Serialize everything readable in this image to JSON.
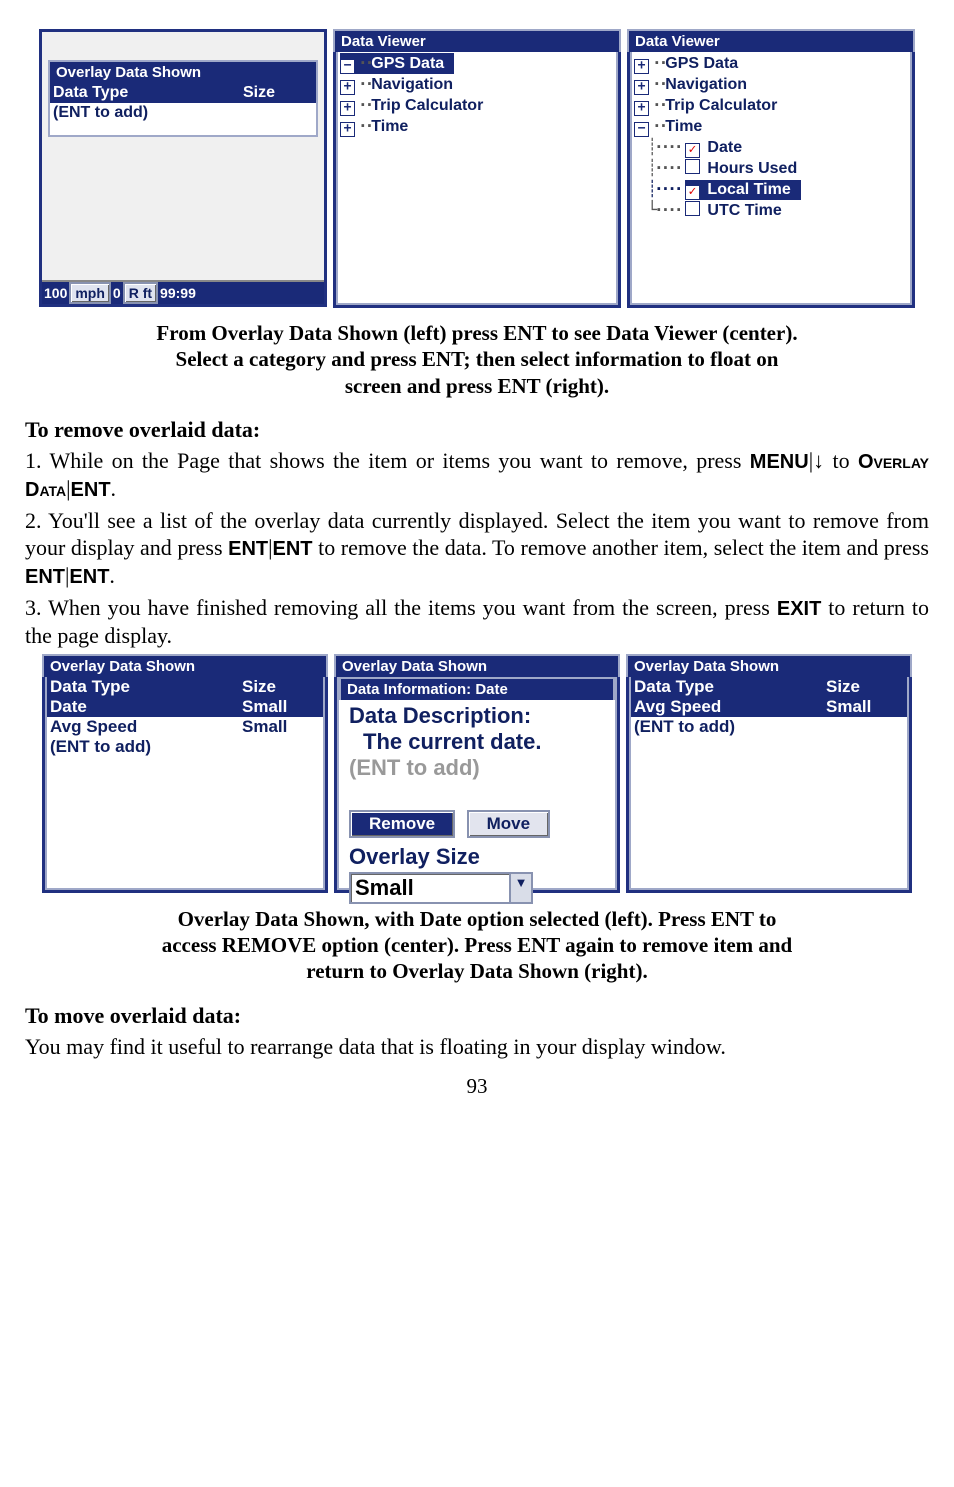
{
  "fig1": {
    "left": {
      "title": "Overlay Data Shown",
      "header_type": "Data Type",
      "header_size": "Size",
      "row1": "(ENT to add)",
      "status": {
        "speed": "100",
        "speed_u": "mph",
        "alt": "0",
        "alt_u": "R ft",
        "time": "99:99"
      }
    },
    "center": {
      "title": "Data Viewer",
      "items": [
        "GPS Data",
        "Navigation",
        "Trip Calculator",
        "Time"
      ]
    },
    "right": {
      "title": "Data Viewer",
      "top": [
        "GPS Data",
        "Navigation",
        "Trip Calculator",
        "Time"
      ],
      "children": [
        "Date",
        "Hours Used",
        "Local Time",
        "UTC Time"
      ]
    }
  },
  "caption1": {
    "l1": "From Overlay Data Shown (left) press ENT to see Data Viewer (center).",
    "l2": "Select a category and press ENT; then select information to float on",
    "l3": "screen and press ENT (right)."
  },
  "sec1": {
    "h": "To remove overlaid data:",
    "p1a": "1. While on the Page that shows the item or items you want to remove, press ",
    "menu": "MENU",
    "arrow": "↓",
    "to": " to ",
    "ov": "Overlay Data",
    "ent": "ENT",
    "p2": "2. You'll see a list of the overlay data currently displayed. Select the item you want to remove from your display and press ",
    "p2b": " to remove the data. To remove another item, select the item and press ",
    "p3": "3. When you have finished removing all the items you want from the screen, press ",
    "exit": "EXIT",
    "p3b": " to return to the page display."
  },
  "fig2": {
    "left": {
      "title": "Overlay Data Shown",
      "rows": [
        {
          "t": "Data Type",
          "s": "Size"
        },
        {
          "t": "Date",
          "s": "Small"
        },
        {
          "t": "Avg Speed",
          "s": "Small"
        },
        {
          "t": "(ENT to add)",
          "s": ""
        }
      ]
    },
    "center": {
      "title": "Overlay Data Shown",
      "infotitle": "Data Information: Date",
      "desc1": "Data Description:",
      "desc2": "The current date.",
      "ghost": "(ENT to add)",
      "btn_remove": "Remove",
      "btn_move": "Move",
      "size_label": "Overlay Size",
      "size_value": "Small"
    },
    "right": {
      "title": "Overlay Data Shown",
      "rows": [
        {
          "t": "Data Type",
          "s": "Size"
        },
        {
          "t": "Avg Speed",
          "s": "Small"
        },
        {
          "t": "(ENT to add)",
          "s": ""
        }
      ]
    }
  },
  "caption2": {
    "l1": "Overlay Data Shown, with Date option selected (left). Press ENT to",
    "l2": "access REMOVE option (center). Press ENT again to remove item and",
    "l3": "return to Overlay Data Shown (right)."
  },
  "sec2": {
    "h": "To move overlaid data:",
    "p": "You may find it useful to rearrange data that is floating in your display window."
  },
  "page": "93"
}
